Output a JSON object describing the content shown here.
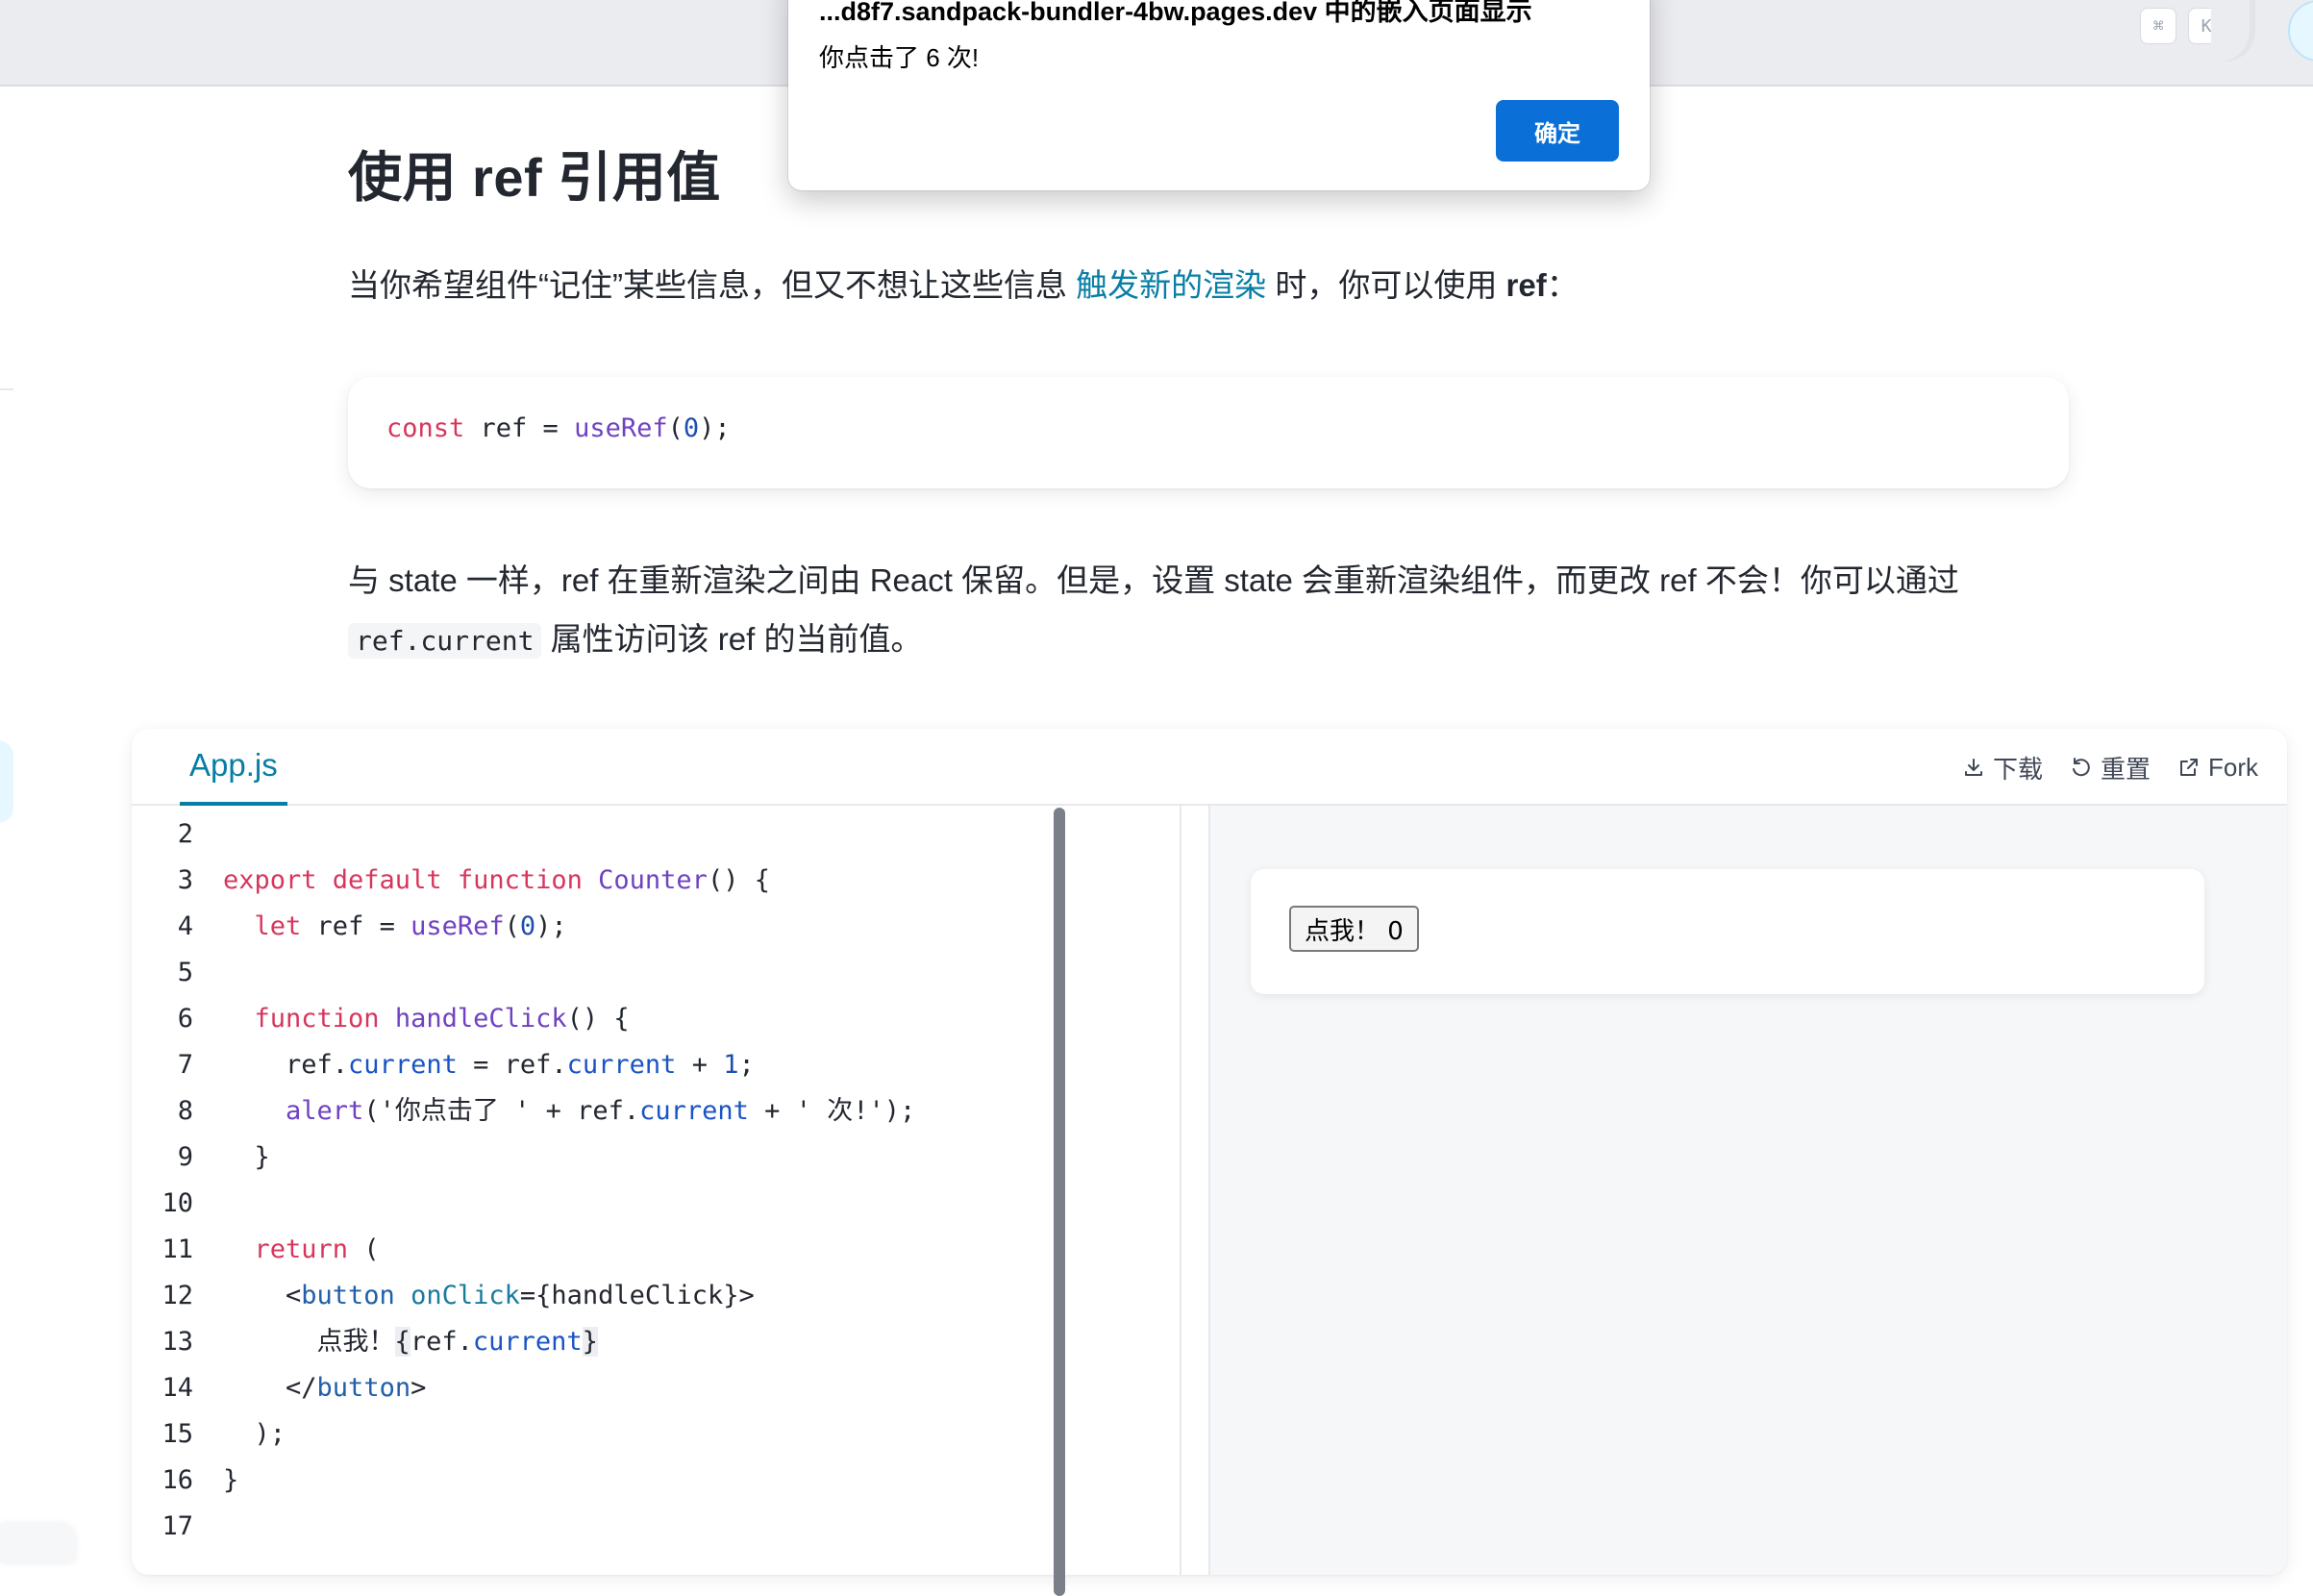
{
  "topbar": {
    "kbd_cmd": "⌘",
    "kbd_k": "K"
  },
  "page": {
    "title": "使用 ref 引用值",
    "intro_before": "当你希望组件“记住”某些信息，但又不想让这些信息 ",
    "intro_link": "触发新的渲染",
    "intro_after": " 时，你可以使用 ",
    "intro_bold": "ref",
    "intro_end": "：",
    "code_snippet": {
      "kw": "const",
      "ident": " ref = ",
      "fn": "useRef",
      "open": "(",
      "num": "0",
      "close": ");"
    },
    "para2_line1": "与 state 一样，ref 在重新渲染之间由 React 保留。但是，设置 state 会重新渲染组件，而更改 ref 不会！你可以通过",
    "para2_code": "ref.current",
    "para2_line2": " 属性访问该 ref 的当前值。"
  },
  "sandpack": {
    "tab": "App.js",
    "actions": {
      "download": "下载",
      "reset": "重置",
      "fork": "Fork"
    },
    "line_numbers": [
      "2",
      "3",
      "4",
      "5",
      "6",
      "7",
      "8",
      "9",
      "10",
      "11",
      "12",
      "13",
      "14",
      "15",
      "16",
      "17"
    ],
    "preview_button": "点我！ 0"
  },
  "alert": {
    "title": "...d8f7.sandpack-bundler-4bw.pages.dev 中的嵌入页面显示",
    "message": "你点击了 6 次!",
    "ok": "确定"
  },
  "colors": {
    "link": "#087ea4",
    "keyword": "#d7365c",
    "function": "#6f42c1",
    "ok_button": "#0a6fd6"
  }
}
